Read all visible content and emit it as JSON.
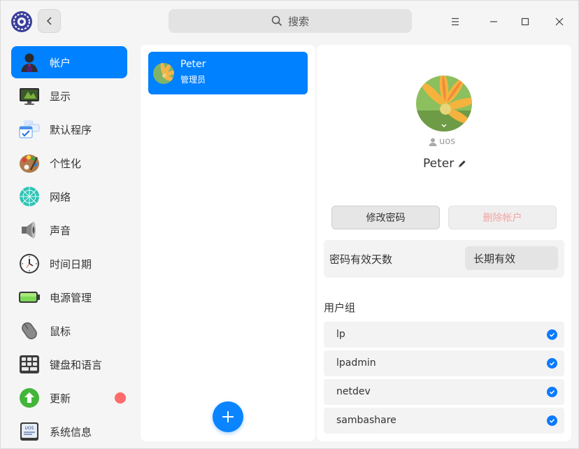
{
  "search": {
    "placeholder": "搜索"
  },
  "sidebar": {
    "items": [
      {
        "label": "帐户",
        "icon": "account-icon",
        "active": true
      },
      {
        "label": "显示",
        "icon": "display-icon"
      },
      {
        "label": "默认程序",
        "icon": "default-apps-icon"
      },
      {
        "label": "个性化",
        "icon": "personalization-icon"
      },
      {
        "label": "网络",
        "icon": "network-icon"
      },
      {
        "label": "声音",
        "icon": "sound-icon"
      },
      {
        "label": "时间日期",
        "icon": "clock-icon"
      },
      {
        "label": "电源管理",
        "icon": "battery-icon"
      },
      {
        "label": "鼠标",
        "icon": "mouse-icon"
      },
      {
        "label": "键盘和语言",
        "icon": "keyboard-icon"
      },
      {
        "label": "更新",
        "icon": "update-icon",
        "badge": true
      },
      {
        "label": "系统信息",
        "icon": "system-info-icon"
      }
    ]
  },
  "users": [
    {
      "name": "Peter",
      "role": "管理员",
      "selected": true
    }
  ],
  "detail": {
    "login_name": "uos",
    "full_name": "Peter",
    "change_password_label": "修改密码",
    "delete_account_label": "删除帐户",
    "password_validity_label": "密码有效天数",
    "password_validity_value": "长期有效",
    "groups_title": "用户组",
    "groups": [
      {
        "name": "lp",
        "checked": true
      },
      {
        "name": "lpadmin",
        "checked": true
      },
      {
        "name": "netdev",
        "checked": true
      },
      {
        "name": "sambashare",
        "checked": true
      }
    ]
  },
  "colors": {
    "accent": "#0081ff",
    "badge": "#ff6b6b",
    "danger_text": "#f5a3a3"
  }
}
